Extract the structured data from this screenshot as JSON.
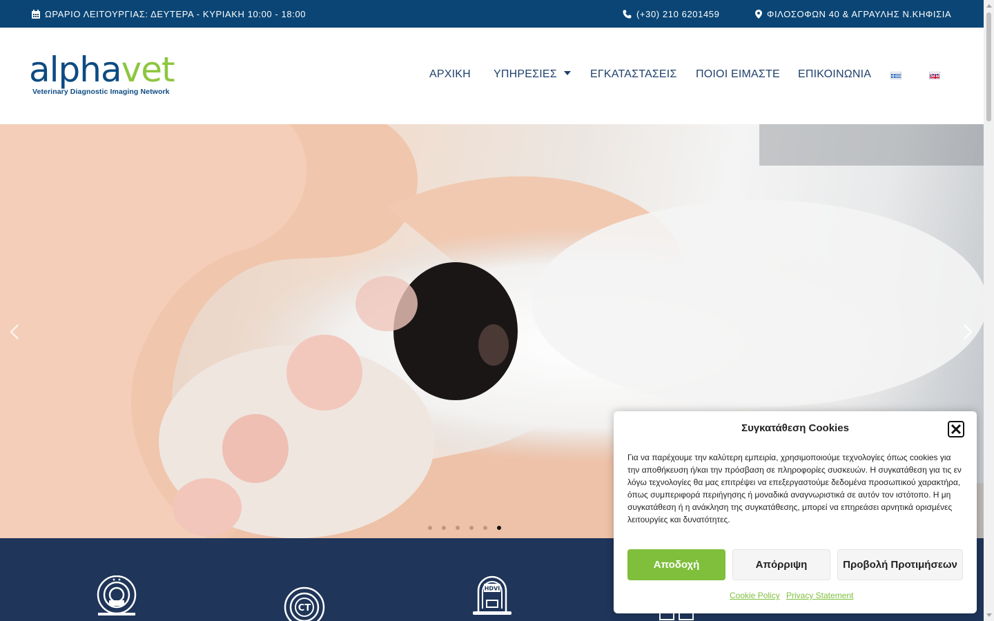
{
  "topbar": {
    "hours": "ΩΡΑΡΙΟ ΛΕΙΤΟΥΡΓΙΑΣ: ΔΕΥΤΕΡΑ - ΚΥΡΙΑΚΗ 10:00 - 18:00",
    "phone": "(+30) 210 6201459",
    "address": "ΦΙΛΟΣΟΦΩΝ 40 & ΑΓΡΑΥΛΗΣ Ν.ΚΗΦΙΣΙΑ",
    "icons": [
      "calendar-icon",
      "phone-icon",
      "map-pin-icon"
    ]
  },
  "logo": {
    "word_main": "alpha",
    "word_accent": "vet",
    "tagline": "Veterinary Diagnostic Imaging Network",
    "colors": {
      "primary": "#0c4b82",
      "accent": "#8dc63f"
    }
  },
  "nav": {
    "home": "ΑΡΧΙΚΗ",
    "services": "ΥΠΗΡΕΣΙΕΣ",
    "facilities": "ΕΓΚΑΤΑΣΤΑΣΕΙΣ",
    "about": "ΠΟΙΟΙ ΕΙΜΑΣΤΕ",
    "contact": "ΕΠΙΚΟΙΝΩΝΙΑ",
    "languages": [
      "greek-flag-icon",
      "english-flag-icon"
    ]
  },
  "hero": {
    "image": "cat paw resting in human hands",
    "slide_count": 6,
    "active_slide": 6
  },
  "services_band": {
    "icons": [
      "mri-scanner-icon",
      "ct-scanner-icon",
      "hdvi-scanner-icon",
      "workstation-icon"
    ],
    "icon_labels": {
      "ct": "CT",
      "hdvi": "HDVI"
    }
  },
  "cookie": {
    "title": "Συγκατάθεση Cookies",
    "body": "Για να παρέχουμε την καλύτερη εμπειρία, χρησιμοποιούμε τεχνολογίες όπως cookies για την αποθήκευση ή/και την πρόσβαση σε πληροφορίες συσκευών. Η συγκατάθεση για τις εν λόγω τεχνολογίες θα μας επιτρέψει να επεξεργαστούμε δεδομένα προσωπικού χαρακτήρα, όπως συμπεριφορά περιήγησης ή μοναδικά αναγνωριστικά σε αυτόν τον ιστότοπο. Η μη συγκατάθεση ή η ανάκληση της συγκατάθεσης, μπορεί να επηρεάσει αρνητικά ορισμένες λειτουργίες και δυνατότητες.",
    "accept": "Αποδοχή",
    "deny": "Απόρριψη",
    "preferences": "Προβολή Προτιμήσεων",
    "cookie_policy": "Cookie Policy",
    "privacy_statement": "Privacy Statement",
    "colors": {
      "accent": "#7fbf3c"
    }
  }
}
